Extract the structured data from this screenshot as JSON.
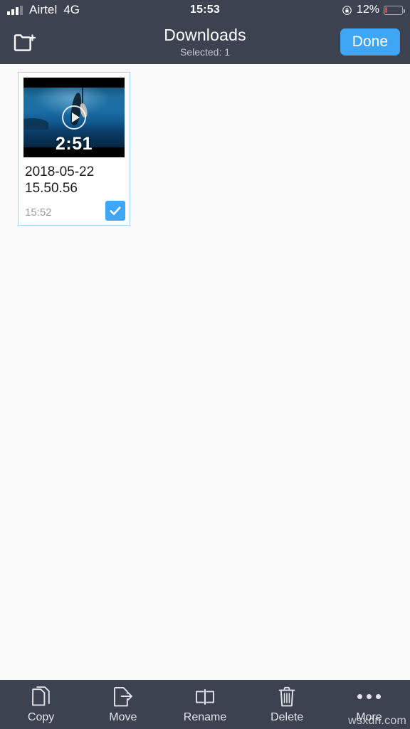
{
  "status_bar": {
    "carrier": "Airtel",
    "network": "4G",
    "time": "15:53",
    "battery_percent": "12%",
    "battery_level": 12,
    "signal_bars": 3,
    "rotation_lock_icon": "rotation-lock-icon",
    "battery_color": "#E8413A"
  },
  "nav_bar": {
    "new_folder_icon": "new-folder-icon",
    "title": "Downloads",
    "subtitle": "Selected: 1",
    "done_label": "Done",
    "accent_color": "#3EA6F5",
    "background_color": "#3C4250"
  },
  "content": {
    "files": [
      {
        "name": "2018-05-22 15.50.56",
        "time": "15:52",
        "duration": "2:51",
        "selected": true,
        "type": "video",
        "play_icon": "play-icon",
        "check_icon": "check-icon"
      }
    ]
  },
  "toolbar": {
    "items": [
      {
        "label": "Copy",
        "icon": "copy-icon"
      },
      {
        "label": "Move",
        "icon": "move-icon"
      },
      {
        "label": "Rename",
        "icon": "rename-icon"
      },
      {
        "label": "Delete",
        "icon": "trash-icon"
      },
      {
        "label": "More",
        "icon": "ellipsis-icon"
      }
    ],
    "background_color": "#3C4250"
  },
  "watermark": {
    "text": "wsxdn.com"
  }
}
